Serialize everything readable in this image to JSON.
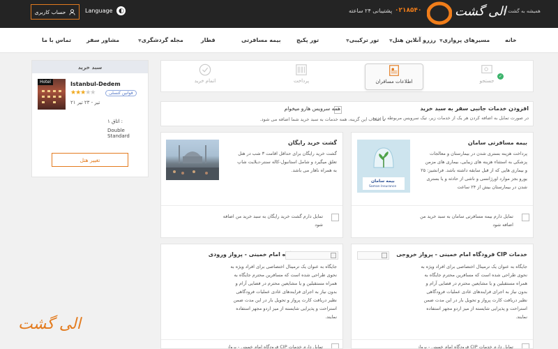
{
  "topbar": {
    "account_label": "حساب کاربری",
    "language_label": "Language",
    "support": "پشتیبانی ۲۴ ساعته",
    "phone": "۰۲۱۸۵۴۰",
    "logo_text": "الی گشت",
    "logo_sub": "همیشه به گشت با"
  },
  "nav": {
    "items": [
      {
        "label": "خانه"
      },
      {
        "label": "مسیرهای پروازی",
        "dropdown": true
      },
      {
        "label": "رزرو آنلاین هتل",
        "dropdown": true
      },
      {
        "label": "تور ترکیبی",
        "dropdown": true
      },
      {
        "label": "تور پکیج"
      },
      {
        "label": "بیمه مسافرتی"
      },
      {
        "label": "قطار"
      },
      {
        "label": "مجله گردشگری",
        "dropdown": true
      },
      {
        "label": "مشاور سفر"
      },
      {
        "label": "تماس با ما"
      }
    ]
  },
  "cart": {
    "title": "سبد خرید",
    "hotel_tag": "Hotel",
    "hotel_name": "Istanbul-Dedem",
    "stars": 3,
    "stars_max": 5,
    "policy_badge": "قوانین کنسلی",
    "dates": "۲۱ تیر - ۲۳ تیر",
    "room_no": "اتاق ۱ :",
    "room_type": "Double Standard",
    "change_button": "تغییر هتل"
  },
  "steps": [
    {
      "label": "جستجو",
      "state": "done"
    },
    {
      "label": "اطلاعات مسافران",
      "state": "active"
    },
    {
      "label": "پرداخت",
      "state": "pending"
    },
    {
      "label": "اتمام خرید",
      "state": "pending"
    }
  ],
  "extras": {
    "title": "افزودن خدمات جانبی سفر به سبد خرید",
    "desc": "در صورت تمایل به اضافه کردن هر یک از خدمات زیر، تیک سرویس مربوطه را بزنید.",
    "all_title": "همه سرویس هارو میخوام",
    "all_desc": "با انتخاب این گزینه، همه خدمات به سبد خرید شما اضافه می شود."
  },
  "cards": {
    "insurance": {
      "title": "بیمه مسافرتی سامان",
      "body": [
        "پرداخت هزینه بستری شدن در بیمارستان و معالجات",
        "پزشکی به استثناء هزینه های زیبایی، بیماری های مزمن",
        "و بیماری هایی که از قبل سابقه داشته باشد. فرانشیز: ۲۵",
        "یورو بجز موارد اورژانسی و ناشی از حادثه و یا بستری",
        "شدن در بیمارستان بیش از ۲۴ ساعت"
      ],
      "option": [
        "تمایل دارم بیمه مسافرتی سامان به سبد خرید من",
        "اضافه شود"
      ],
      "logo_text": "بیمه سامان",
      "logo_sub": "Saman Insurance"
    },
    "tour": {
      "title": "گشت خرید رایگان",
      "body": [
        "گشت خرید رایگان برای حداقل اقامت ۳ شب در هتل",
        "تعلق میگیرد و شامل استانبول-کاله سنتر-دیلایت شاپ",
        "به همراه ناهار می باشد."
      ],
      "option": [
        "تمایل دارم گشت خرید رایگان به سبد خرید من اضافه",
        "شود"
      ]
    },
    "cip_out": {
      "title": "خدمات CIP فرودگاه امام خمینی - پرواز خروجی",
      "body": [
        "جایگاه به عنوان یک ترمینال اختصاصی برای افراد ویژه به",
        "نحوی طراحی شده است که مسافرین محترم جایگاه به",
        "همراه مستقبلین و یا مشایعین محترم در فضایی آرام و",
        "بدون نیاز به اجرای فرایندهای عادی عملیات فرودگاهی",
        "نظیر دریافت کارت پرواز و تحویل بار در این مدت ضمن",
        "استراحت و پذیرایی شایسته از میز اردو مجهز استفاده",
        "نمایند."
      ],
      "option": [
        "تمایل دارم خدمات CIP فرودگاه امام خمینی - پرواز"
      ]
    },
    "cip_in": {
      "title": "خدمات CIP فرودگاه امام خمینی - پرواز ورودی",
      "body": [
        "جایگاه به عنوان یک ترمینال اختصاصی برای افراد ویژه به",
        "نحوی طراحی شده است که مسافرین محترم جایگاه به",
        "همراه مستقبلین و یا مشایعین محترم در فضایی آرام و",
        "بدون نیاز به اجرای فرایندهای عادی عملیات فرودگاهی",
        "نظیر دریافت کارت پرواز و تحویل بار در این مدت ضمن",
        "استراحت و پذیرایی شایسته از میز اردو مجهز استفاده",
        "نمایند."
      ],
      "option": [
        "تمایل دارم خدمات CIP فرودگاه امام خمینی - پرواز"
      ]
    }
  },
  "footer_logo": "الی گشت",
  "colors": {
    "accent": "#e37b1e",
    "topbar": "#242424",
    "success": "#3bb36b"
  }
}
